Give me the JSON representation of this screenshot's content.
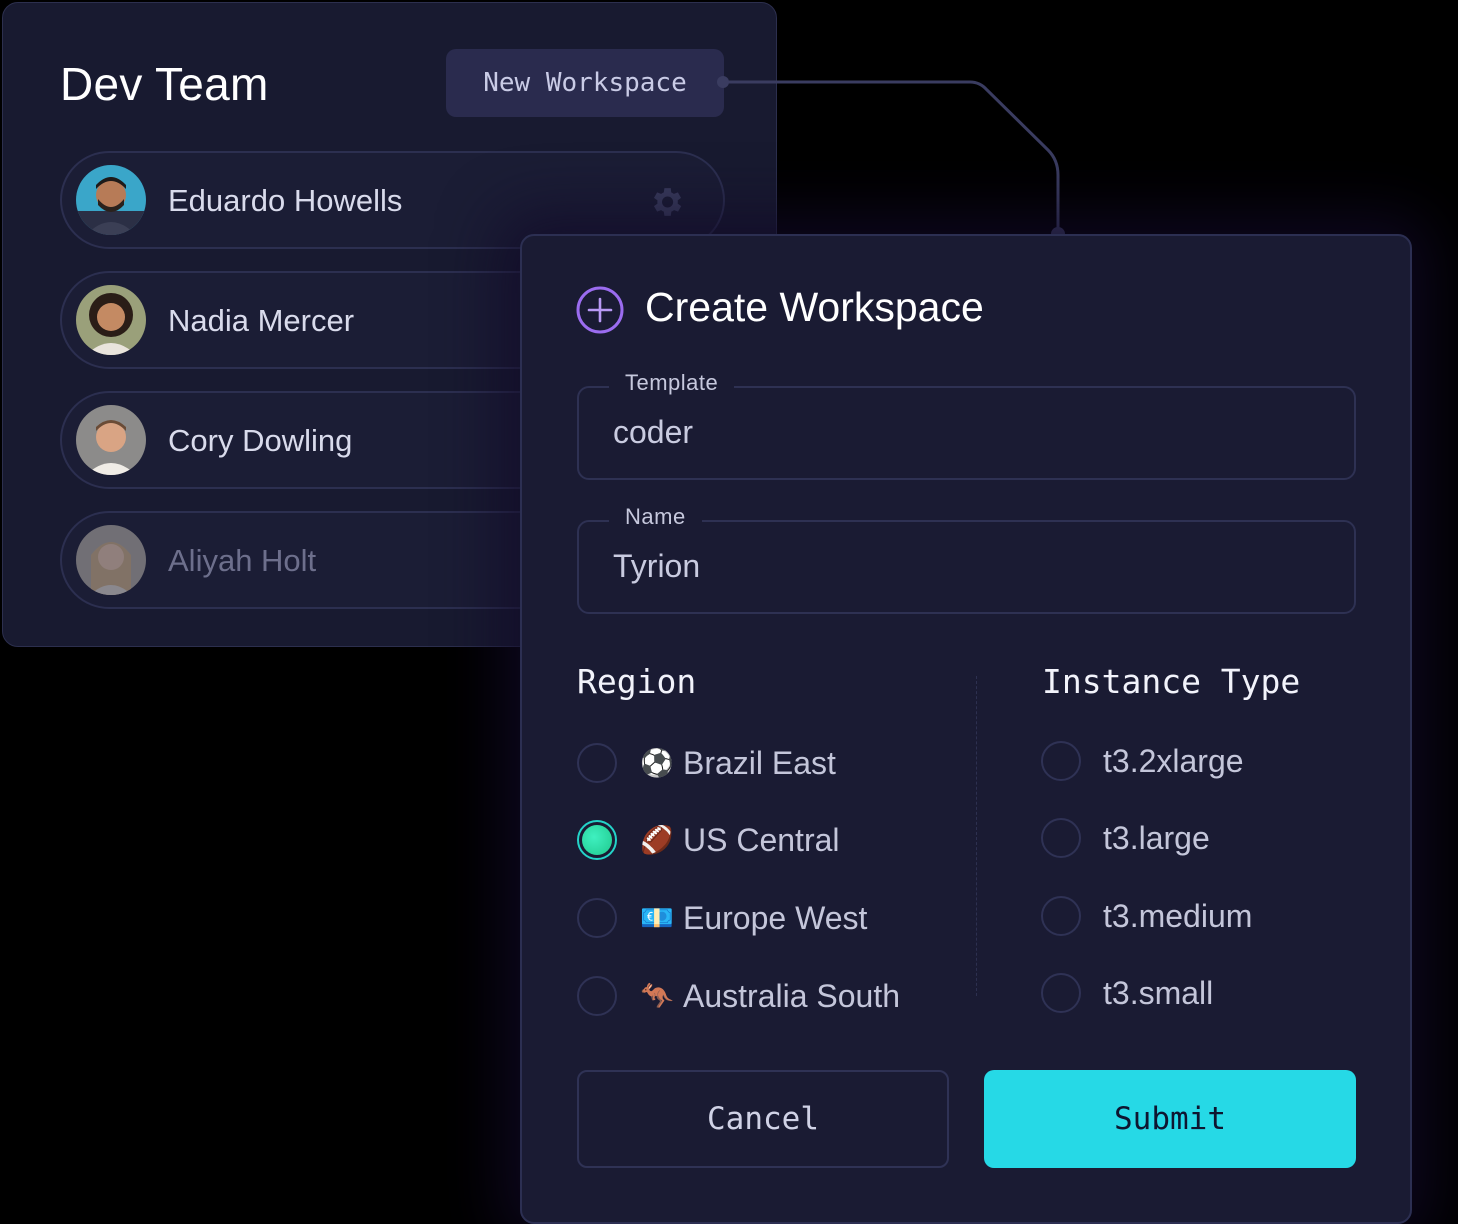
{
  "team": {
    "title": "Dev Team",
    "new_workspace_label": "New Workspace",
    "members": [
      {
        "name": "Eduardo Howells",
        "state": "active"
      },
      {
        "name": "Nadia Mercer",
        "state": "normal"
      },
      {
        "name": "Cory Dowling",
        "state": "normal"
      },
      {
        "name": "Aliyah Holt",
        "state": "dimmed"
      }
    ]
  },
  "dialog": {
    "title": "Create Workspace",
    "template": {
      "label": "Template",
      "value": "coder"
    },
    "name": {
      "label": "Name",
      "value": "Tyrion"
    },
    "region": {
      "title": "Region",
      "options": [
        {
          "emoji": "⚽",
          "label": "Brazil East",
          "selected": false
        },
        {
          "emoji": "🏈",
          "label": "US Central",
          "selected": true
        },
        {
          "emoji": "💶",
          "label": "Europe West",
          "selected": false
        },
        {
          "emoji": "🦘",
          "label": "Australia South",
          "selected": false
        }
      ]
    },
    "instance_type": {
      "title": "Instance Type",
      "options": [
        {
          "label": "t3.2xlarge",
          "selected": false
        },
        {
          "label": "t3.large",
          "selected": false
        },
        {
          "label": "t3.medium",
          "selected": false
        },
        {
          "label": "t3.small",
          "selected": false
        }
      ]
    },
    "cancel_label": "Cancel",
    "submit_label": "Submit"
  },
  "colors": {
    "background": "#000000",
    "panel": "#181a30",
    "dialog": "#1a1b33",
    "accent_submit": "#26d9e6",
    "radio_selected": "#24d3c8",
    "plus_icon": "#9b6cf0"
  }
}
